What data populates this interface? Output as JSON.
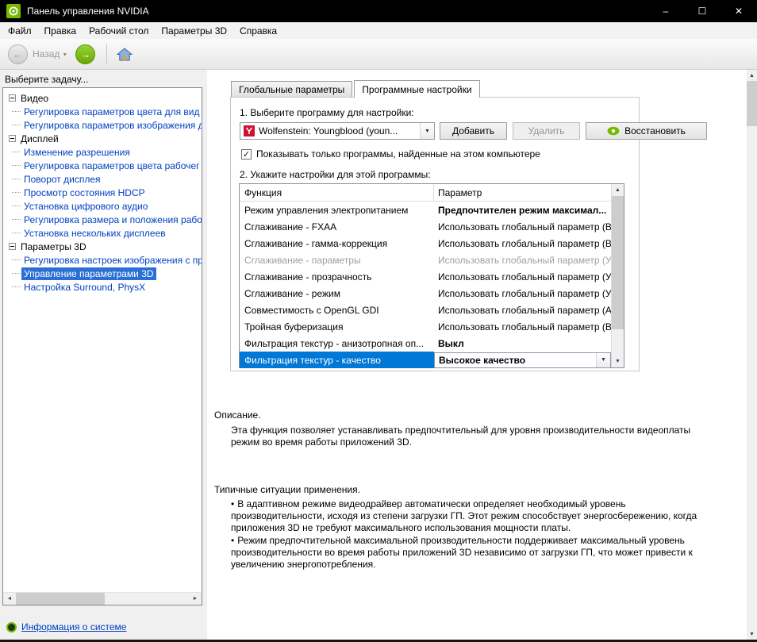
{
  "window": {
    "title": "Панель управления NVIDIA"
  },
  "icons": {
    "minimize": "–",
    "maximize": "☐",
    "close": "✕",
    "back_arrow": "←",
    "forward_arrow": "→",
    "dropdown_chevron": "▼",
    "combo_arrow": "▼",
    "scroll_up": "▲",
    "scroll_down": "▼",
    "scroll_left": "◄",
    "scroll_right": "►",
    "check": "✓",
    "bullet": "•"
  },
  "colors": {
    "nvidia_green": "#76b900",
    "selection_blue": "#0078d7",
    "tree_selection_blue": "#2a6fd3",
    "link_blue": "#0040c0",
    "titlebar_black": "#000000"
  },
  "menubar": {
    "items": [
      "Файл",
      "Правка",
      "Рабочий стол",
      "Параметры 3D",
      "Справка"
    ]
  },
  "toolbar": {
    "back_label": "Назад"
  },
  "sidebar": {
    "header": "Выберите задачу...",
    "groups": [
      {
        "label": "Видео",
        "items": [
          "Регулировка параметров цвета для вид",
          "Регулировка параметров изображения д"
        ]
      },
      {
        "label": "Дисплей",
        "items": [
          "Изменение разрешения",
          "Регулировка параметров цвета рабочег",
          "Поворот дисплея",
          "Просмотр состояния HDCP",
          "Установка цифрового аудио",
          "Регулировка размера и положения рабо",
          "Установка нескольких дисплеев"
        ]
      },
      {
        "label": "Параметры 3D",
        "items": [
          "Регулировка настроек изображения с пр",
          "Управление параметрами 3D",
          "Настройка Surround, PhysX"
        ]
      }
    ],
    "system_info_label": "Информация о системе"
  },
  "main": {
    "tabs": [
      "Глобальные параметры",
      "Программные настройки"
    ],
    "step1_label": "1. Выберите программу для настройки:",
    "program_combo_value": "Wolfenstein: Youngblood (youn...",
    "buttons": {
      "add": "Добавить",
      "remove": "Удалить",
      "restore": "Восстановить"
    },
    "checkbox_label": "Показывать только программы, найденные на этом компьютере",
    "step2_label": "2. Укажите настройки для этой программы:",
    "table": {
      "columns": [
        "Функция",
        "Параметр"
      ],
      "rows": [
        {
          "feature": "Режим управления электропитанием",
          "value": "Предпочтителен режим максимал..."
        },
        {
          "feature": "Сглаживание - FXAA",
          "value": "Использовать глобальный параметр (В...)"
        },
        {
          "feature": "Сглаживание - гамма-коррекция",
          "value": "Использовать глобальный параметр (Вкл)"
        },
        {
          "feature": "Сглаживание - параметры",
          "value": "Использовать глобальный параметр (У...)"
        },
        {
          "feature": "Сглаживание - прозрачность",
          "value": "Использовать глобальный параметр (У...)"
        },
        {
          "feature": "Сглаживание - режим",
          "value": "Использовать глобальный параметр (У...)"
        },
        {
          "feature": "Совместимость с OpenGL GDI",
          "value": "Использовать глобальный параметр (А...)"
        },
        {
          "feature": "Тройная буферизация",
          "value": "Использовать глобальный параметр (В...)"
        },
        {
          "feature": "Фильтрация текстур - анизотропная оп...",
          "value": "Выкл"
        },
        {
          "feature": "Фильтрация текстур - качество",
          "value": "Высокое качество"
        }
      ]
    },
    "description": {
      "title": "Описание.",
      "body": "Эта функция позволяет устанавливать предпочтительный для уровня производительности видеоплаты режим во время работы приложений 3D.",
      "usage_title": "Типичные ситуации применения.",
      "bullets": [
        "В адаптивном режиме видеодрайвер автоматически определяет необходимый уровень производительности, исходя из степени загрузки ГП. Этот режим способствует энергосбережению, когда приложения 3D не требуют максимального использования мощности платы.",
        "Режим предпочтительной максимальной производительности поддерживает максимальный уровень производительности во время работы приложений 3D независимо от загрузки ГП, что может привести к увеличению энергопотребления."
      ]
    }
  }
}
